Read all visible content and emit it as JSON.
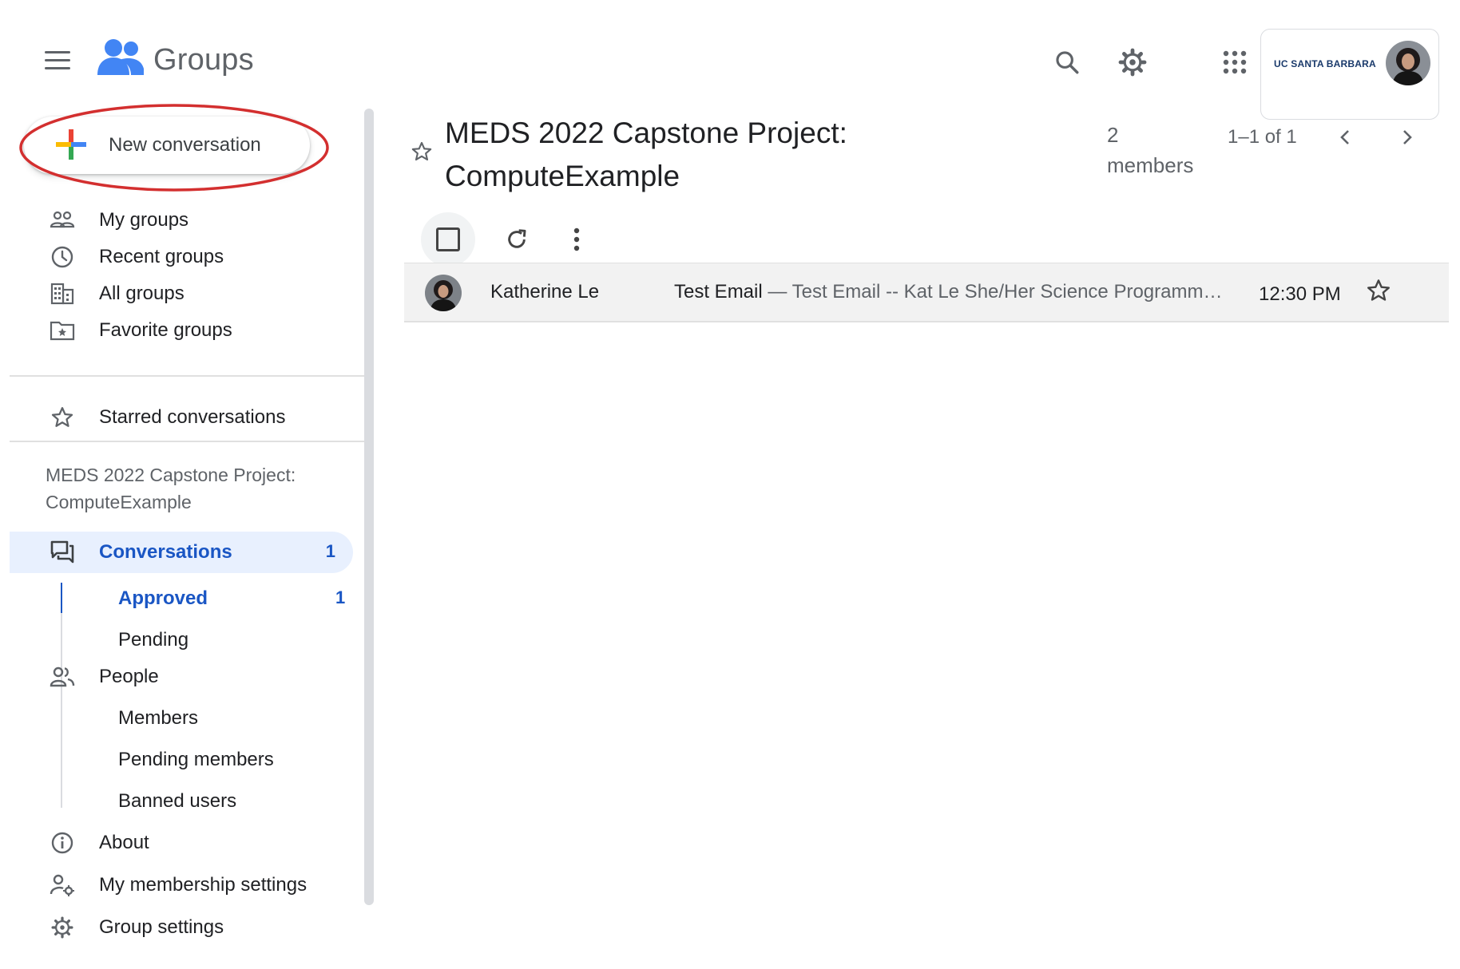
{
  "header": {
    "app_name": "Groups",
    "account_org": "UC SANTA BARBARA"
  },
  "sidebar": {
    "new_conversation_label": "New conversation",
    "nav": [
      {
        "label": "My groups",
        "icon": "groups-icon"
      },
      {
        "label": "Recent groups",
        "icon": "clock-icon"
      },
      {
        "label": "All groups",
        "icon": "building-icon"
      },
      {
        "label": "Favorite groups",
        "icon": "folder-star-icon"
      }
    ],
    "starred_label": "Starred conversations",
    "group_name": "MEDS 2022 Capstone Project: ComputeExample",
    "conversations": {
      "label": "Conversations",
      "count": "1"
    },
    "approved": {
      "label": "Approved",
      "count": "1"
    },
    "pending_label": "Pending",
    "people_label": "People",
    "members_label": "Members",
    "pending_members_label": "Pending members",
    "banned_users_label": "Banned users",
    "about_label": "About",
    "membership_settings_label": "My membership settings",
    "group_settings_label": "Group settings"
  },
  "main": {
    "title": "MEDS 2022 Capstone Project: ComputeExample",
    "member_count": "2",
    "member_unit": "members",
    "pagination": "1–1 of 1",
    "conversations": [
      {
        "sender": "Katherine Le",
        "subject": "Test Email",
        "separator": " — ",
        "snippet": "Test Email -- Kat Le She/Her Science Programmin...",
        "time": "12:30 PM"
      }
    ]
  },
  "colors": {
    "accent": "#1a56c4",
    "active_bg": "#e8f0fe",
    "highlight_annotation": "#d32f2f"
  }
}
